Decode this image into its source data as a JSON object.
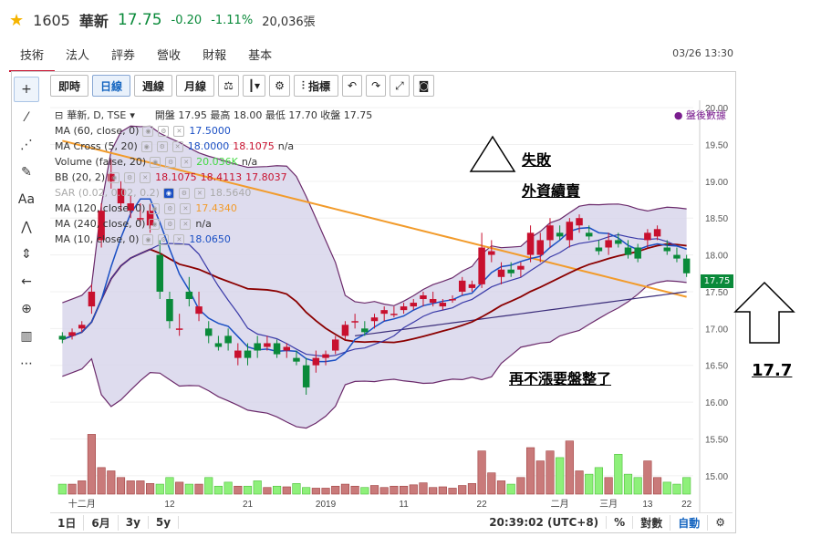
{
  "header": {
    "code": "1605",
    "name": "華新",
    "price": "17.75",
    "change": "-0.20",
    "change_pct": "-1.11%",
    "volume": "20,036張"
  },
  "tabs": [
    "技術",
    "法人",
    "評券",
    "營收",
    "財報",
    "基本"
  ],
  "datetime": "03/26 13:30",
  "toolbar": {
    "buttons": [
      "即時",
      "日線",
      "週線",
      "月線"
    ],
    "indicators_label": "指標",
    "active": "日線"
  },
  "legend": [
    {
      "label": "華新, D, TSE",
      "extra": "開盤 17.95 最高 18.00 最低 17.70 收盤 17.75"
    },
    {
      "label": "MA (60, close, 0)",
      "values": [
        "17.5000"
      ],
      "colors": [
        "#1a4fc4"
      ]
    },
    {
      "label": "MA Cross (5, 20)",
      "values": [
        "18.0000",
        "18.1075",
        "n/a"
      ],
      "colors": [
        "#1a4fc4",
        "#c8102e",
        "#333333"
      ]
    },
    {
      "label": "Volume (false, 20)",
      "values": [
        "20.036K",
        "n/a"
      ],
      "colors": [
        "#44d944",
        "#333333"
      ]
    },
    {
      "label": "BB (20, 2)",
      "values": [
        "18.1075",
        "18.4113",
        "17.8037"
      ],
      "colors": [
        "#c8102e",
        "#c8102e",
        "#c8102e"
      ]
    },
    {
      "label": "SAR (0.02, 0.02, 0.2)",
      "values": [
        "18.5640"
      ],
      "colors": [
        "#999999"
      ]
    },
    {
      "label": "MA (120, close, 0)",
      "values": [
        "17.4340"
      ],
      "colors": [
        "#f29b2b"
      ]
    },
    {
      "label": "MA (240, close, 0)",
      "values": [
        "n/a"
      ],
      "colors": [
        "#333333"
      ]
    },
    {
      "label": "MA (10, close, 0)",
      "values": [
        "18.0650"
      ],
      "colors": [
        "#1a4fc4"
      ]
    }
  ],
  "after_hours": "盤後數據",
  "last_price_tag": "17.75",
  "annotations": {
    "fail": "失敗",
    "foreign": "外資續賣",
    "consolidate": "再不漲要盤整了",
    "arrow_value": "17.7"
  },
  "bottom": {
    "ranges": [
      "1日",
      "6月",
      "3y",
      "5y"
    ],
    "time": "20:39:02 (UTC+8)",
    "pct": "%",
    "log": "對數",
    "auto": "自動"
  },
  "colors": {
    "up": "#c8102e",
    "down": "#0a8a3a",
    "bb_fill": "#d6d3ea",
    "ma120": "#f29b2b",
    "ma20": "#8b0000"
  },
  "chart_data": {
    "type": "candlestick",
    "y_range": [
      14.75,
      20.1
    ],
    "y_ticks": [
      15.0,
      15.5,
      16.0,
      16.5,
      17.0,
      17.5,
      18.0,
      18.5,
      19.0,
      19.5,
      20.0
    ],
    "x_tick_labels": [
      "十二月",
      "12",
      "21",
      "2019",
      "11",
      "22",
      "二月",
      "三月",
      "13",
      "22"
    ],
    "candles": [
      [
        16.9,
        16.95,
        16.8,
        16.85
      ],
      [
        16.9,
        17.0,
        16.85,
        16.95
      ],
      [
        17.0,
        17.1,
        16.95,
        17.05
      ],
      [
        17.3,
        17.6,
        17.2,
        17.5
      ],
      [
        18.2,
        18.7,
        18.1,
        18.6
      ],
      [
        19.0,
        19.3,
        18.9,
        19.1
      ],
      [
        18.7,
        19.0,
        18.6,
        18.9
      ],
      [
        18.6,
        18.8,
        18.5,
        18.7
      ],
      [
        18.5,
        18.7,
        18.4,
        18.5
      ],
      [
        18.4,
        18.7,
        18.3,
        18.6
      ],
      [
        18.0,
        18.2,
        17.4,
        17.5
      ],
      [
        17.4,
        17.5,
        17.0,
        17.1
      ],
      [
        17.0,
        17.2,
        16.9,
        17.0
      ],
      [
        17.5,
        17.7,
        17.3,
        17.4
      ],
      [
        17.2,
        17.5,
        17.1,
        17.3
      ],
      [
        17.0,
        17.1,
        16.8,
        16.9
      ],
      [
        16.8,
        16.9,
        16.7,
        16.75
      ],
      [
        16.9,
        17.0,
        16.7,
        16.8
      ],
      [
        16.6,
        16.8,
        16.5,
        16.7
      ],
      [
        16.7,
        16.8,
        16.5,
        16.6
      ],
      [
        16.8,
        16.9,
        16.6,
        16.7
      ],
      [
        16.75,
        16.9,
        16.7,
        16.8
      ],
      [
        16.8,
        16.85,
        16.6,
        16.65
      ],
      [
        16.7,
        16.8,
        16.6,
        16.75
      ],
      [
        16.6,
        16.7,
        16.5,
        16.55
      ],
      [
        16.5,
        16.6,
        16.1,
        16.2
      ],
      [
        16.5,
        16.7,
        16.4,
        16.6
      ],
      [
        16.6,
        16.7,
        16.5,
        16.65
      ],
      [
        16.7,
        16.9,
        16.65,
        16.85
      ],
      [
        16.9,
        17.1,
        16.85,
        17.05
      ],
      [
        17.1,
        17.2,
        17.0,
        17.1
      ],
      [
        17.0,
        17.1,
        16.9,
        16.95
      ],
      [
        17.1,
        17.2,
        17.0,
        17.15
      ],
      [
        17.2,
        17.3,
        17.1,
        17.25
      ],
      [
        17.2,
        17.3,
        17.15,
        17.2
      ],
      [
        17.25,
        17.35,
        17.2,
        17.3
      ],
      [
        17.3,
        17.4,
        17.25,
        17.35
      ],
      [
        17.4,
        17.5,
        17.3,
        17.45
      ],
      [
        17.35,
        17.5,
        17.3,
        17.4
      ],
      [
        17.3,
        17.4,
        17.25,
        17.35
      ],
      [
        17.4,
        17.45,
        17.35,
        17.4
      ],
      [
        17.5,
        17.7,
        17.45,
        17.65
      ],
      [
        17.55,
        17.65,
        17.5,
        17.6
      ],
      [
        17.6,
        18.3,
        17.55,
        18.1
      ],
      [
        18.0,
        18.2,
        17.9,
        18.05
      ],
      [
        17.7,
        17.9,
        17.6,
        17.8
      ],
      [
        17.8,
        17.9,
        17.7,
        17.75
      ],
      [
        17.8,
        17.9,
        17.7,
        17.85
      ],
      [
        18.0,
        18.4,
        17.9,
        18.3
      ],
      [
        18.0,
        18.3,
        17.9,
        18.2
      ],
      [
        18.2,
        18.5,
        18.1,
        18.4
      ],
      [
        18.3,
        18.4,
        18.2,
        18.25
      ],
      [
        18.2,
        18.5,
        18.1,
        18.45
      ],
      [
        18.4,
        18.55,
        18.3,
        18.5
      ],
      [
        18.3,
        18.4,
        18.2,
        18.25
      ],
      [
        18.1,
        18.2,
        18.0,
        18.05
      ],
      [
        18.1,
        18.3,
        18.0,
        18.2
      ],
      [
        18.2,
        18.3,
        18.1,
        18.15
      ],
      [
        18.1,
        18.2,
        17.95,
        18.0
      ],
      [
        18.1,
        18.15,
        17.9,
        17.95
      ],
      [
        18.2,
        18.35,
        18.1,
        18.3
      ],
      [
        18.25,
        18.4,
        18.2,
        18.35
      ],
      [
        18.1,
        18.2,
        18.0,
        18.05
      ],
      [
        18.0,
        18.1,
        17.9,
        17.95
      ],
      [
        17.95,
        18.0,
        17.7,
        17.75
      ]
    ],
    "volume_range": [
      0,
      14000
    ],
    "volumes": [
      1500,
      1500,
      2000,
      9000,
      4000,
      3500,
      2500,
      2000,
      2000,
      1600,
      1500,
      2500,
      1800,
      1500,
      1500,
      2500,
      1200,
      1800,
      1200,
      1200,
      2000,
      1000,
      1200,
      1100,
      1600,
      1000,
      900,
      900,
      1200,
      1500,
      1200,
      1000,
      1300,
      1000,
      1200,
      1200,
      1400,
      1700,
      1000,
      1100,
      900,
      1300,
      1600,
      6500,
      3200,
      2000,
      1500,
      2500,
      7000,
      5000,
      6500,
      5500,
      8000,
      3500,
      3000,
      4000,
      2500,
      6000,
      3000,
      2500,
      5000,
      2500,
      1800,
      1500,
      2500
    ]
  }
}
